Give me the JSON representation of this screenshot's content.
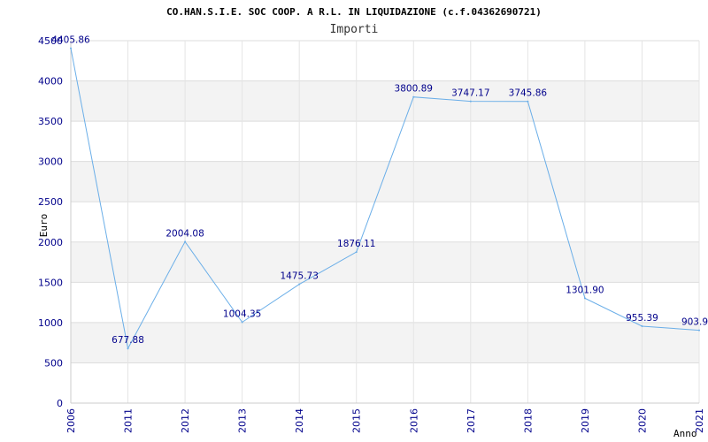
{
  "chart_data": {
    "type": "line",
    "title": "CO.HAN.S.I.E. SOC COOP. A R.L. IN LIQUIDAZIONE (c.f.04362690721)",
    "subtitle": "Importi",
    "xlabel": "Anno",
    "ylabel": "Euro",
    "x": [
      "2006",
      "2011",
      "2012",
      "2013",
      "2014",
      "2015",
      "2016",
      "2017",
      "2018",
      "2019",
      "2020",
      "2021"
    ],
    "values": [
      4405.86,
      677.88,
      2004.08,
      1004.35,
      1475.73,
      1876.11,
      3800.89,
      3747.17,
      3745.86,
      1301.9,
      955.39,
      903.9
    ],
    "data_labels": [
      "4405.86",
      "677.88",
      "2004.08",
      "1004.35",
      "1475.73",
      "1876.11",
      "3800.89",
      "3747.17",
      "3745.86",
      "1301.90",
      "955.39",
      "903.9"
    ],
    "ylim": [
      0,
      4500
    ],
    "yticks": [
      0,
      500,
      1000,
      1500,
      2000,
      2500,
      3000,
      3500,
      4000,
      4500
    ],
    "grid": true,
    "band_colors": [
      "#ffffff",
      "#f3f3f3"
    ],
    "line_color": "#6aaee8",
    "tick_color": "#00008b"
  }
}
